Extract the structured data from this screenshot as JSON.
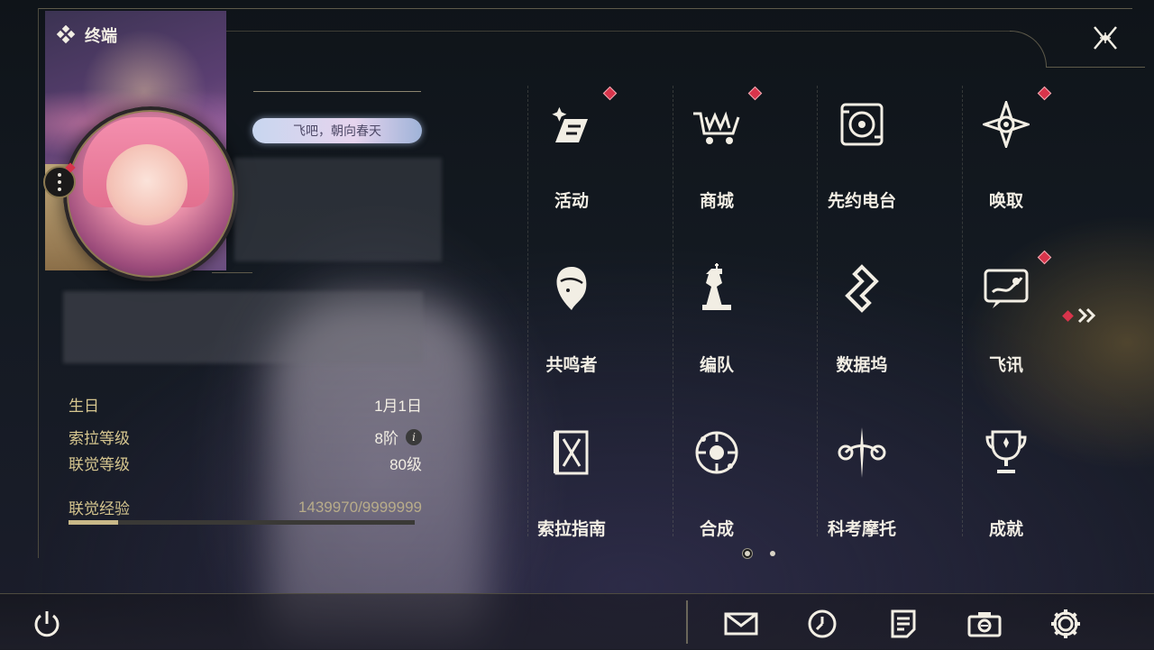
{
  "header": {
    "title": "终端"
  },
  "profile": {
    "signature": "飞吧，朝向春天",
    "stats": [
      {
        "label": "生日",
        "value": "1月1日"
      },
      {
        "label": "索拉等级",
        "value": "8阶"
      },
      {
        "label": "联觉等级",
        "value": "80级"
      }
    ],
    "experience": {
      "label": "联觉经验",
      "value": "1439970/9999999",
      "progress": 0.144
    }
  },
  "menu": {
    "items": [
      {
        "label": "活动",
        "icon": "event-icon",
        "badge": true
      },
      {
        "label": "商城",
        "icon": "shop-cart-icon",
        "badge": true
      },
      {
        "label": "先约电台",
        "icon": "radio-icon",
        "badge": false
      },
      {
        "label": "唤取",
        "icon": "compass-star-icon",
        "badge": true
      },
      {
        "label": "共鸣者",
        "icon": "resonator-icon",
        "badge": false
      },
      {
        "label": "编队",
        "icon": "chess-team-icon",
        "badge": false
      },
      {
        "label": "数据坞",
        "icon": "data-dock-icon",
        "badge": false
      },
      {
        "label": "飞讯",
        "icon": "message-icon",
        "badge": true
      },
      {
        "label": "索拉指南",
        "icon": "guide-icon",
        "badge": false
      },
      {
        "label": "合成",
        "icon": "synthesis-icon",
        "badge": false
      },
      {
        "label": "科考摩托",
        "icon": "motorcycle-icon",
        "badge": false
      },
      {
        "label": "成就",
        "icon": "trophy-icon",
        "badge": false
      }
    ],
    "pages": 2,
    "current_page": 1
  },
  "bottom_bar": {
    "icons": [
      "power-icon",
      "mail-icon",
      "clock-icon",
      "notes-icon",
      "camera-icon",
      "settings-icon"
    ]
  },
  "colors": {
    "accent_gold": "#d6c68f",
    "badge_red": "#d8344b",
    "text": "#f2eee4"
  }
}
